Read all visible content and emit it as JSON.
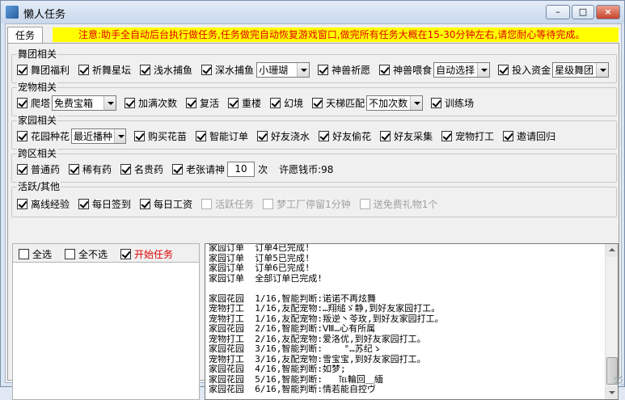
{
  "window": {
    "title": "懒人任务",
    "minimize": "–",
    "maximize": "□",
    "close": "×"
  },
  "tab": {
    "label": "任务"
  },
  "notice": "注意:助手全自动后台执行做任务,任务做完自动恢复游戏窗口,做完所有任务大概在15-30分钟左右,请您耐心等待完成。",
  "groups": {
    "dance": {
      "title": "舞团相关",
      "items": [
        {
          "label": "舞团福利",
          "checked": true
        },
        {
          "label": "祈舞星坛",
          "checked": true
        },
        {
          "label": "浅水捕鱼",
          "checked": true
        },
        {
          "label": "深水捕鱼",
          "checked": true
        },
        {
          "label": "神兽祈愿",
          "checked": true
        },
        {
          "label": "神兽喂食",
          "checked": true
        },
        {
          "label": "投入资金",
          "checked": true
        }
      ],
      "combos": {
        "deep_fishing": "小珊瑚",
        "beast_feed": "自动选择",
        "invest": "星级舞团"
      }
    },
    "pet": {
      "title": "宠物相关",
      "items": [
        {
          "label": "爬塔",
          "checked": true
        },
        {
          "label": "加满次数",
          "checked": true
        },
        {
          "label": "复活",
          "checked": true
        },
        {
          "label": "重楼",
          "checked": true
        },
        {
          "label": "幻境",
          "checked": true
        },
        {
          "label": "天梯匹配",
          "checked": true
        },
        {
          "label": "训练场",
          "checked": true
        }
      ],
      "combos": {
        "tower": "免费宝箱",
        "ladder": "不加次数"
      }
    },
    "home": {
      "title": "家园相关",
      "items": [
        {
          "label": "花园种花",
          "checked": true
        },
        {
          "label": "购买花苗",
          "checked": true
        },
        {
          "label": "智能订单",
          "checked": true
        },
        {
          "label": "好友浇水",
          "checked": true
        },
        {
          "label": "好友偷花",
          "checked": true
        },
        {
          "label": "好友采集",
          "checked": true
        },
        {
          "label": "宠物打工",
          "checked": true
        },
        {
          "label": "邀请回归",
          "checked": true
        }
      ],
      "combos": {
        "garden": "最近播种"
      }
    },
    "cross": {
      "title": "跨区相关",
      "items": [
        {
          "label": "普通药",
          "checked": true
        },
        {
          "label": "稀有药",
          "checked": true
        },
        {
          "label": "名贵药",
          "checked": true
        },
        {
          "label": "老张请神",
          "checked": true
        }
      ],
      "times_value": "10",
      "times_unit": "次",
      "wish_coins": "许愿钱币:98"
    },
    "active": {
      "title": "活跃/其他",
      "items": [
        {
          "label": "离线经验",
          "checked": true,
          "enabled": true
        },
        {
          "label": "每日签到",
          "checked": true,
          "enabled": true
        },
        {
          "label": "每日工资",
          "checked": true,
          "enabled": true
        },
        {
          "label": "活跃任务",
          "checked": false,
          "enabled": false
        },
        {
          "label": "梦工厂停留1分钟",
          "checked": false,
          "enabled": false
        },
        {
          "label": "送免费礼物1个",
          "checked": false,
          "enabled": false
        }
      ]
    }
  },
  "controls": {
    "select_all": {
      "label": "全选",
      "checked": false
    },
    "select_none": {
      "label": "全不选",
      "checked": false
    },
    "start": {
      "label": "开始任务",
      "checked": true
    }
  },
  "log": [
    "家园订单  订单4已完成!",
    "家园订单  订单5已完成!",
    "家园订单  订单6已完成!",
    "家园订单  全部订单已完成!",
    "",
    "家园花园  1/16,智能判断:诺诺不再炫舞",
    "宠物打工  1/16,友配宠物:…翔缒ゞ静,到好友家园打工。",
    "宠物打工  1/16,友配宠物:叛逆丶苓玫,到好友家园打工。",
    "家园花园  2/16,智能判断:Ⅷ…心有所属",
    "宠物打工  2/16,友配宠物:爱洛优,到好友家园打工。",
    "家园花园  3/16,智能判断:    °…苏纪ゝ",
    "宠物打工  3/16,友配宠物:雪宝宝,到好友家园打工。",
    "家园花园  4/16,智能判断:如梦;",
    "家园花园  5/16,智能判断:   ℡輪回＿緬",
    "家园花园  6/16,智能判断:情若能自控ヴ"
  ]
}
